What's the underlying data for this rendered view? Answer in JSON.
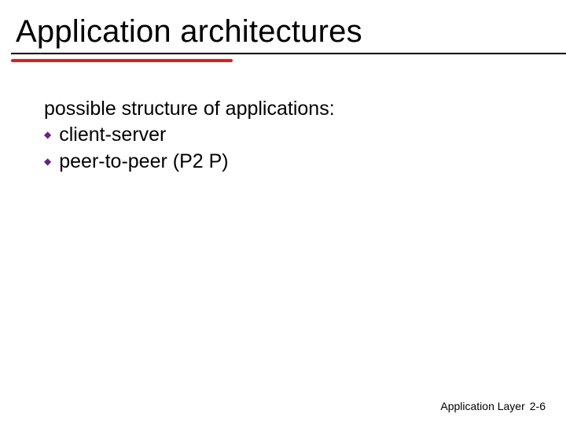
{
  "title": "Application architectures",
  "intro": "possible structure of applications:",
  "bullets": [
    {
      "label": "client-server"
    },
    {
      "label": "peer-to-peer (P2 P)"
    }
  ],
  "footer": {
    "section": "Application Layer",
    "page": "2-6"
  },
  "colors": {
    "accent_red": "#c62828",
    "bullet_purple": "#6b1f8a"
  }
}
